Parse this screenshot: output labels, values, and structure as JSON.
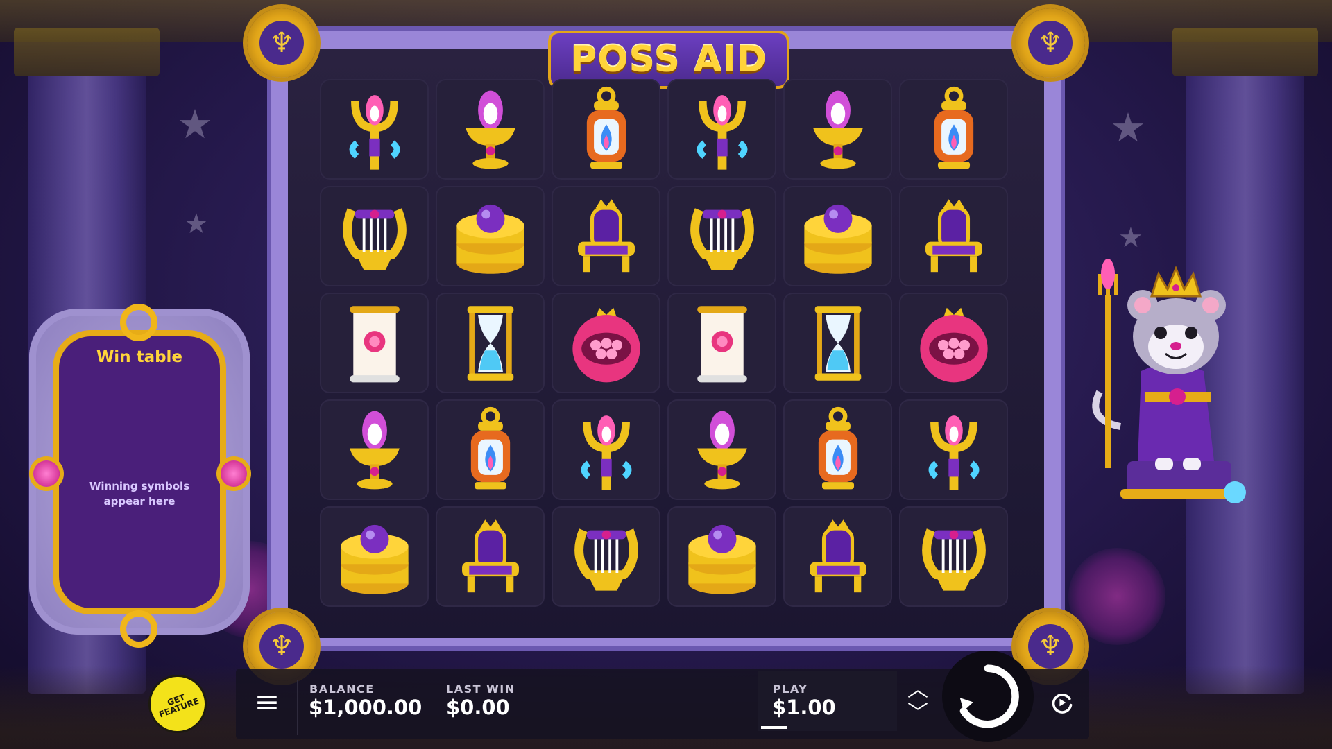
{
  "game": {
    "title": "POSS AID"
  },
  "colors": {
    "accent_gold": "#f0b61a",
    "frame_purple": "#9a86d8",
    "panel_purple": "#4a1f7a",
    "gem_pink": "#d61f8e"
  },
  "reels": {
    "rows": [
      [
        "trident-icon",
        "fire-chalice-icon",
        "lantern-icon",
        "trident-icon",
        "fire-chalice-icon",
        "lantern-icon"
      ],
      [
        "lyre-icon",
        "gold-coins-icon",
        "throne-icon",
        "lyre-icon",
        "gold-coins-icon",
        "throne-icon"
      ],
      [
        "scroll-icon",
        "hourglass-icon",
        "pomegranate-icon",
        "scroll-icon",
        "hourglass-icon",
        "pomegranate-icon"
      ],
      [
        "fire-chalice-icon",
        "lantern-icon",
        "trident-icon",
        "fire-chalice-icon",
        "lantern-icon",
        "trident-icon"
      ],
      [
        "gold-coins-icon",
        "throne-icon",
        "lyre-icon",
        "gold-coins-icon",
        "throne-icon",
        "lyre-icon"
      ]
    ]
  },
  "win_table": {
    "title": "Win table",
    "message": "Winning symbols appear here"
  },
  "controls": {
    "get_feature": [
      "GET",
      "FEATURE"
    ],
    "balance_label": "BALANCE",
    "balance_value": "$1,000.00",
    "last_win_label": "LAST WIN",
    "last_win_value": "$0.00",
    "play_label": "PLAY",
    "play_value": "$1.00",
    "menu_icon": "hamburger-menu-icon",
    "bet_up_icon": "chevron-up-icon",
    "bet_down_icon": "chevron-down-icon",
    "spin_icon": "spin-arrow-icon",
    "autoplay_icon": "autoplay-icon"
  }
}
